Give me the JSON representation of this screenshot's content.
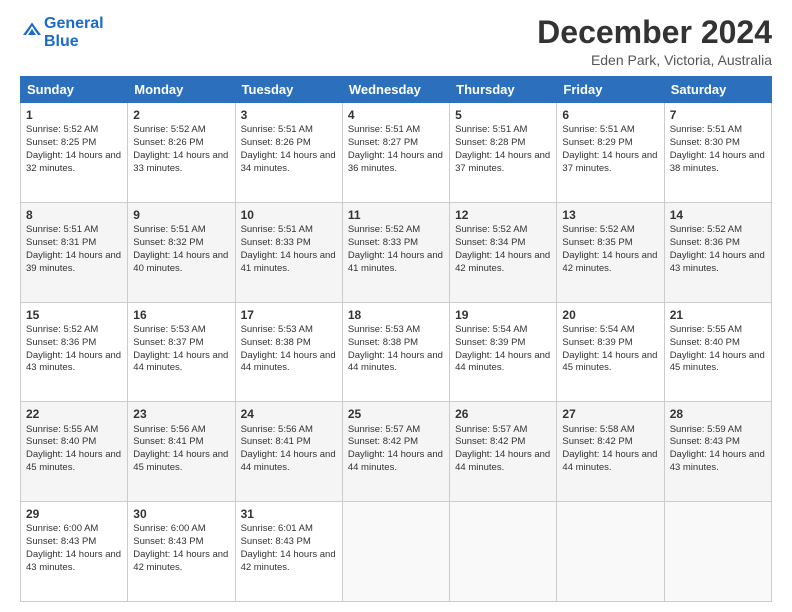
{
  "logo": {
    "line1": "General",
    "line2": "Blue"
  },
  "title": "December 2024",
  "location": "Eden Park, Victoria, Australia",
  "days_header": [
    "Sunday",
    "Monday",
    "Tuesday",
    "Wednesday",
    "Thursday",
    "Friday",
    "Saturday"
  ],
  "weeks": [
    [
      {
        "num": "1",
        "sunrise": "Sunrise: 5:52 AM",
        "sunset": "Sunset: 8:25 PM",
        "daylight": "Daylight: 14 hours and 32 minutes."
      },
      {
        "num": "2",
        "sunrise": "Sunrise: 5:52 AM",
        "sunset": "Sunset: 8:26 PM",
        "daylight": "Daylight: 14 hours and 33 minutes."
      },
      {
        "num": "3",
        "sunrise": "Sunrise: 5:51 AM",
        "sunset": "Sunset: 8:26 PM",
        "daylight": "Daylight: 14 hours and 34 minutes."
      },
      {
        "num": "4",
        "sunrise": "Sunrise: 5:51 AM",
        "sunset": "Sunset: 8:27 PM",
        "daylight": "Daylight: 14 hours and 36 minutes."
      },
      {
        "num": "5",
        "sunrise": "Sunrise: 5:51 AM",
        "sunset": "Sunset: 8:28 PM",
        "daylight": "Daylight: 14 hours and 37 minutes."
      },
      {
        "num": "6",
        "sunrise": "Sunrise: 5:51 AM",
        "sunset": "Sunset: 8:29 PM",
        "daylight": "Daylight: 14 hours and 37 minutes."
      },
      {
        "num": "7",
        "sunrise": "Sunrise: 5:51 AM",
        "sunset": "Sunset: 8:30 PM",
        "daylight": "Daylight: 14 hours and 38 minutes."
      }
    ],
    [
      {
        "num": "8",
        "sunrise": "Sunrise: 5:51 AM",
        "sunset": "Sunset: 8:31 PM",
        "daylight": "Daylight: 14 hours and 39 minutes."
      },
      {
        "num": "9",
        "sunrise": "Sunrise: 5:51 AM",
        "sunset": "Sunset: 8:32 PM",
        "daylight": "Daylight: 14 hours and 40 minutes."
      },
      {
        "num": "10",
        "sunrise": "Sunrise: 5:51 AM",
        "sunset": "Sunset: 8:33 PM",
        "daylight": "Daylight: 14 hours and 41 minutes."
      },
      {
        "num": "11",
        "sunrise": "Sunrise: 5:52 AM",
        "sunset": "Sunset: 8:33 PM",
        "daylight": "Daylight: 14 hours and 41 minutes."
      },
      {
        "num": "12",
        "sunrise": "Sunrise: 5:52 AM",
        "sunset": "Sunset: 8:34 PM",
        "daylight": "Daylight: 14 hours and 42 minutes."
      },
      {
        "num": "13",
        "sunrise": "Sunrise: 5:52 AM",
        "sunset": "Sunset: 8:35 PM",
        "daylight": "Daylight: 14 hours and 42 minutes."
      },
      {
        "num": "14",
        "sunrise": "Sunrise: 5:52 AM",
        "sunset": "Sunset: 8:36 PM",
        "daylight": "Daylight: 14 hours and 43 minutes."
      }
    ],
    [
      {
        "num": "15",
        "sunrise": "Sunrise: 5:52 AM",
        "sunset": "Sunset: 8:36 PM",
        "daylight": "Daylight: 14 hours and 43 minutes."
      },
      {
        "num": "16",
        "sunrise": "Sunrise: 5:53 AM",
        "sunset": "Sunset: 8:37 PM",
        "daylight": "Daylight: 14 hours and 44 minutes."
      },
      {
        "num": "17",
        "sunrise": "Sunrise: 5:53 AM",
        "sunset": "Sunset: 8:38 PM",
        "daylight": "Daylight: 14 hours and 44 minutes."
      },
      {
        "num": "18",
        "sunrise": "Sunrise: 5:53 AM",
        "sunset": "Sunset: 8:38 PM",
        "daylight": "Daylight: 14 hours and 44 minutes."
      },
      {
        "num": "19",
        "sunrise": "Sunrise: 5:54 AM",
        "sunset": "Sunset: 8:39 PM",
        "daylight": "Daylight: 14 hours and 44 minutes."
      },
      {
        "num": "20",
        "sunrise": "Sunrise: 5:54 AM",
        "sunset": "Sunset: 8:39 PM",
        "daylight": "Daylight: 14 hours and 45 minutes."
      },
      {
        "num": "21",
        "sunrise": "Sunrise: 5:55 AM",
        "sunset": "Sunset: 8:40 PM",
        "daylight": "Daylight: 14 hours and 45 minutes."
      }
    ],
    [
      {
        "num": "22",
        "sunrise": "Sunrise: 5:55 AM",
        "sunset": "Sunset: 8:40 PM",
        "daylight": "Daylight: 14 hours and 45 minutes."
      },
      {
        "num": "23",
        "sunrise": "Sunrise: 5:56 AM",
        "sunset": "Sunset: 8:41 PM",
        "daylight": "Daylight: 14 hours and 45 minutes."
      },
      {
        "num": "24",
        "sunrise": "Sunrise: 5:56 AM",
        "sunset": "Sunset: 8:41 PM",
        "daylight": "Daylight: 14 hours and 44 minutes."
      },
      {
        "num": "25",
        "sunrise": "Sunrise: 5:57 AM",
        "sunset": "Sunset: 8:42 PM",
        "daylight": "Daylight: 14 hours and 44 minutes."
      },
      {
        "num": "26",
        "sunrise": "Sunrise: 5:57 AM",
        "sunset": "Sunset: 8:42 PM",
        "daylight": "Daylight: 14 hours and 44 minutes."
      },
      {
        "num": "27",
        "sunrise": "Sunrise: 5:58 AM",
        "sunset": "Sunset: 8:42 PM",
        "daylight": "Daylight: 14 hours and 44 minutes."
      },
      {
        "num": "28",
        "sunrise": "Sunrise: 5:59 AM",
        "sunset": "Sunset: 8:43 PM",
        "daylight": "Daylight: 14 hours and 43 minutes."
      }
    ],
    [
      {
        "num": "29",
        "sunrise": "Sunrise: 6:00 AM",
        "sunset": "Sunset: 8:43 PM",
        "daylight": "Daylight: 14 hours and 43 minutes."
      },
      {
        "num": "30",
        "sunrise": "Sunrise: 6:00 AM",
        "sunset": "Sunset: 8:43 PM",
        "daylight": "Daylight: 14 hours and 42 minutes."
      },
      {
        "num": "31",
        "sunrise": "Sunrise: 6:01 AM",
        "sunset": "Sunset: 8:43 PM",
        "daylight": "Daylight: 14 hours and 42 minutes."
      },
      null,
      null,
      null,
      null
    ]
  ]
}
